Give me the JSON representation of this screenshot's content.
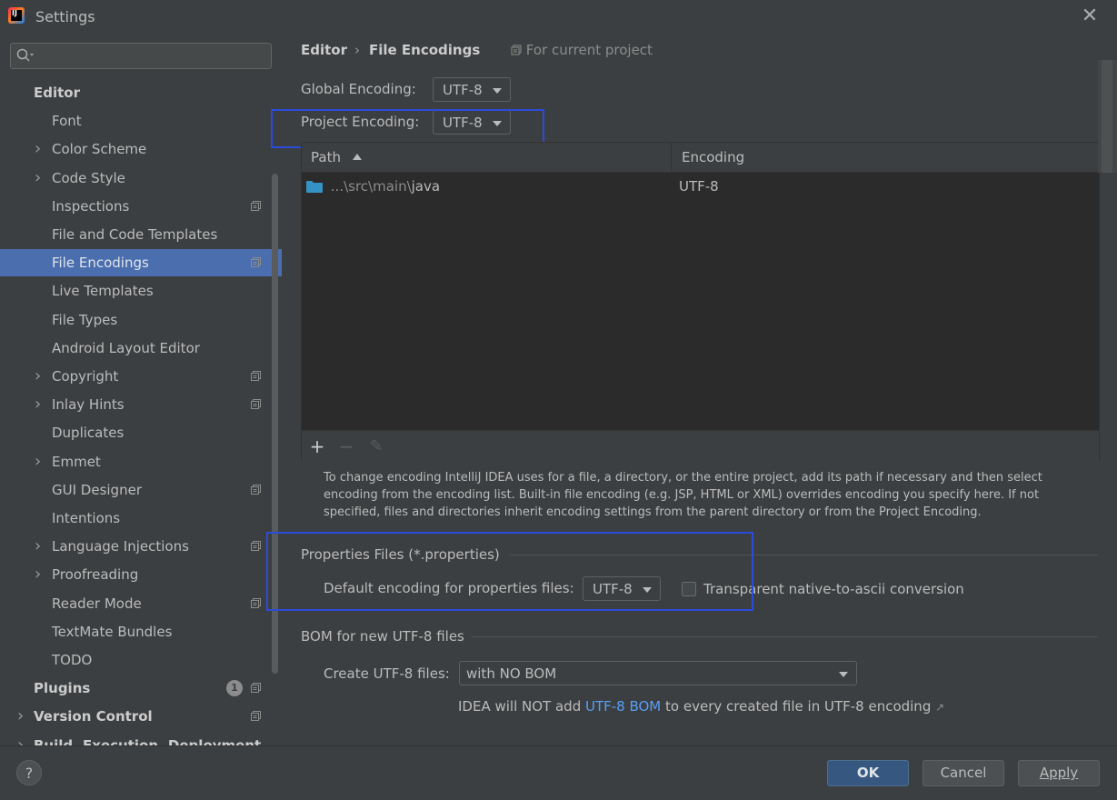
{
  "window": {
    "title": "Settings"
  },
  "search": {
    "placeholder": ""
  },
  "sidebar": {
    "items": [
      {
        "label": "Editor",
        "bold": true,
        "expandable": false,
        "project": false
      },
      {
        "label": "Font",
        "expandable": false,
        "project": false
      },
      {
        "label": "Color Scheme",
        "expandable": true,
        "project": false
      },
      {
        "label": "Code Style",
        "expandable": true,
        "project": false
      },
      {
        "label": "Inspections",
        "expandable": false,
        "project": true
      },
      {
        "label": "File and Code Templates",
        "expandable": false,
        "project": false
      },
      {
        "label": "File Encodings",
        "expandable": false,
        "project": true,
        "selected": true
      },
      {
        "label": "Live Templates",
        "expandable": false,
        "project": false
      },
      {
        "label": "File Types",
        "expandable": false,
        "project": false
      },
      {
        "label": "Android Layout Editor",
        "expandable": false,
        "project": false
      },
      {
        "label": "Copyright",
        "expandable": true,
        "project": true
      },
      {
        "label": "Inlay Hints",
        "expandable": true,
        "project": true
      },
      {
        "label": "Duplicates",
        "expandable": false,
        "project": false
      },
      {
        "label": "Emmet",
        "expandable": true,
        "project": false
      },
      {
        "label": "GUI Designer",
        "expandable": false,
        "project": true
      },
      {
        "label": "Intentions",
        "expandable": false,
        "project": false
      },
      {
        "label": "Language Injections",
        "expandable": true,
        "project": true
      },
      {
        "label": "Proofreading",
        "expandable": true,
        "project": false
      },
      {
        "label": "Reader Mode",
        "expandable": false,
        "project": true
      },
      {
        "label": "TextMate Bundles",
        "expandable": false,
        "project": false
      },
      {
        "label": "TODO",
        "expandable": false,
        "project": false
      },
      {
        "label": "Plugins",
        "bold": true,
        "badge": "1",
        "project": true
      },
      {
        "label": "Version Control",
        "bold": true,
        "expandable": true,
        "project": true
      },
      {
        "label": "Build, Execution, Deployment",
        "bold": true,
        "expandable": true,
        "project": false
      }
    ]
  },
  "header": {
    "crumb_editor": "Editor",
    "crumb_sep": "›",
    "crumb_page": "File Encodings",
    "for_current_project": "For current project"
  },
  "global_encoding": {
    "label": "Global Encoding:",
    "value": "UTF-8"
  },
  "project_encoding": {
    "label": "Project Encoding:",
    "value": "UTF-8"
  },
  "table": {
    "columns": [
      "Path",
      "Encoding"
    ],
    "rows": [
      {
        "path_prefix": "...\\src\\main\\",
        "path_leaf": "java",
        "encoding": "UTF-8"
      }
    ],
    "toolbar": {
      "add": "+",
      "remove": "−",
      "edit": "✎"
    }
  },
  "help_text": "To change encoding IntelliJ IDEA uses for a file, a directory, or the entire project, add its path if necessary and then select encoding from the encoding list. Built-in file encoding (e.g. JSP, HTML or XML) overrides encoding you specify here. If not specified, files and directories inherit encoding settings from the parent directory or from the Project Encoding.",
  "properties": {
    "title": "Properties Files (*.properties)",
    "default_label": "Default encoding for properties files:",
    "default_value": "UTF-8",
    "transparent_label": "Transparent native-to-ascii conversion",
    "transparent_checked": false
  },
  "bom": {
    "title": "BOM for new UTF-8 files",
    "create_label": "Create UTF-8 files:",
    "create_value": "with NO BOM",
    "note_before": "IDEA will NOT add ",
    "note_link": "UTF-8 BOM",
    "note_after": " to every created file in UTF-8 encoding",
    "note_arrow": "↗"
  },
  "footer": {
    "help": "?",
    "ok": "OK",
    "cancel": "Cancel",
    "apply": "Apply"
  },
  "colors": {
    "background": "#3c3f41",
    "selection": "#4b6eaf",
    "highlight_box": "#2b4bdc",
    "link": "#589df6",
    "primary_button": "#365880"
  }
}
